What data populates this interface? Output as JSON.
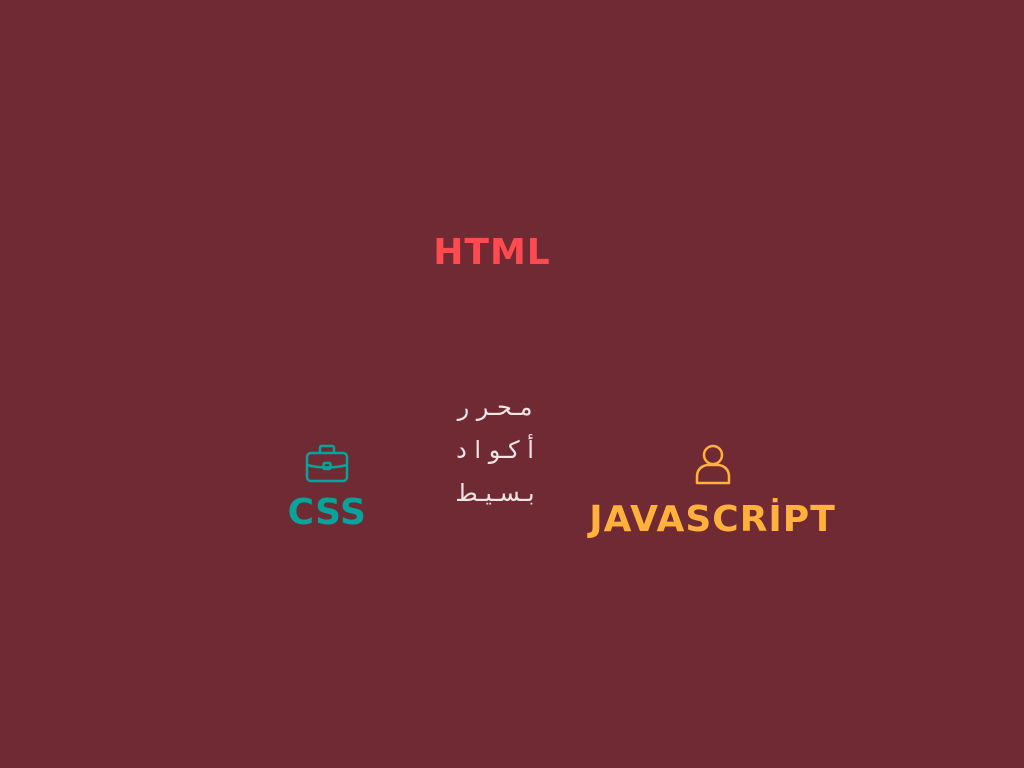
{
  "headings": {
    "html": "HTML",
    "css": "CSS",
    "javascript": "JAVASCRİPT"
  },
  "center_text": "مـحـر ر\nأ كـو ا د\nبـسـيـط",
  "icons": {
    "css": "briefcase-icon",
    "javascript": "user-icon"
  },
  "colors": {
    "background": "#6f2a34",
    "html": "#ff4a4f",
    "css": "#07a49c",
    "javascript": "#ffb13b",
    "text": "#f3e5e6"
  }
}
